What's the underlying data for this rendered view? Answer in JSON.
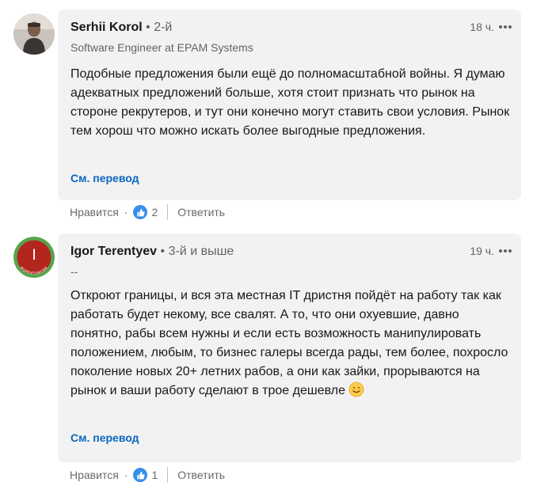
{
  "comments": [
    {
      "author": "Serhii Korol",
      "degree": "• 2-й",
      "headline": "Software Engineer at EPAM Systems",
      "time": "18 ч.",
      "text": "Подобные предложения были ещё до полномасштабной войны. Я думаю адекватных предложений больше, хотя стоит признать что рынок на стороне рекрутеров, и тут они конечно могут ставить свои условия. Рынок тем хорош что можно искать более выгодные предложения.",
      "translate_label": "См. перевод",
      "like_label": "Нравится",
      "separator": "·",
      "reactions_count": "2",
      "reply_label": "Ответить"
    },
    {
      "author": "Igor Terentyev",
      "degree": "• 3-й и выше",
      "headline": "--",
      "avatar_letter": "I",
      "avatar_badge_text": "#OPENTOWORK",
      "time": "19 ч.",
      "text": "Откроют границы, и вся эта местная IT дристня пойдёт на работу так как работать будет некому, все свалят. А то, что они охуевшие, давно понятно, рабы всем нужны и если есть возможность манипулировать положением, любым, то бизнес галеры всегда рады, тем более, похросло поколение новых 20+ летних рабов, а они как зайки, прорываются на рынок и ваши работу сделают в трое дешевле",
      "emoji": "smiling-face-emoji",
      "translate_label": "См. перевод",
      "like_label": "Нравится",
      "separator": "·",
      "reactions_count": "1",
      "reply_label": "Ответить"
    }
  ],
  "colors": {
    "bubble_bg": "#f2f2f2",
    "link": "#0a66c2",
    "like_badge": "#378fe9",
    "avatar_red": "#b3261e",
    "opentowork_green": "#57a44c"
  }
}
